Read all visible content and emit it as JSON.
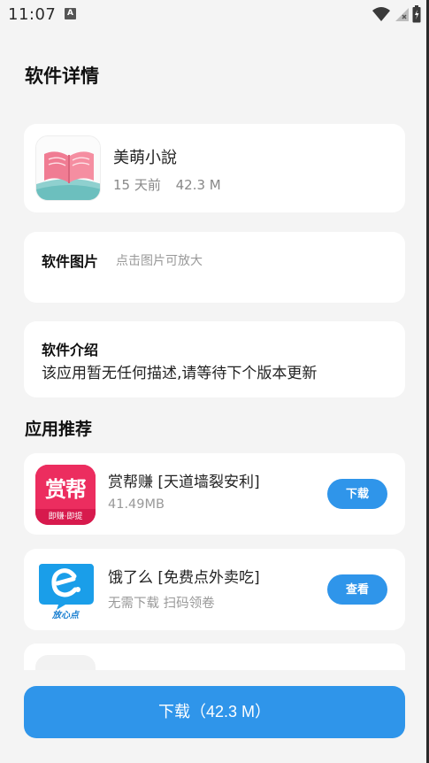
{
  "status_bar": {
    "time": "11:07",
    "notification_letter": "A"
  },
  "page": {
    "title": "软件详情"
  },
  "app": {
    "name": "美萌小說",
    "updated": "15 天前",
    "size": "42.3 M",
    "icon": "open-book-icon"
  },
  "screenshots": {
    "label": "软件图片",
    "hint": "点击图片可放大"
  },
  "intro": {
    "label": "软件介绍",
    "text": "该应用暂无任何描述,请等待下个版本更新"
  },
  "recommend": {
    "heading": "应用推荐",
    "items": [
      {
        "name": "赏帮赚 [天道墙裂安利]",
        "sub": "41.49MB",
        "button": "下载",
        "icon_text": "赏帮",
        "icon_caption": "即赚·即提",
        "icon": "shangbang-logo-icon"
      },
      {
        "name": "饿了么 [免费点外卖吃]",
        "sub": "无需下载 扫码领卷",
        "button": "查看",
        "icon_caption": "放心点",
        "icon": "eleme-logo-icon"
      }
    ]
  },
  "download": {
    "label": "下载（42.3 M）"
  },
  "colors": {
    "accent": "#2f95ea",
    "background": "#f4f4f4",
    "card": "#ffffff",
    "muted_text": "#888888"
  }
}
